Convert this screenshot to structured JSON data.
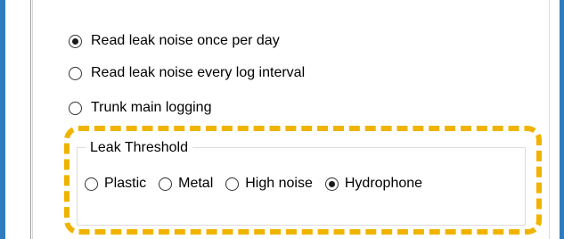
{
  "options": [
    {
      "label": "Read leak noise once per day",
      "checked": true
    },
    {
      "label": "Read leak noise every log interval",
      "checked": false
    },
    {
      "label": "Trunk main logging",
      "checked": false
    }
  ],
  "leak_threshold": {
    "title": "Leak Threshold",
    "options": [
      {
        "label": "Plastic",
        "checked": false
      },
      {
        "label": "Metal",
        "checked": false
      },
      {
        "label": "High noise",
        "checked": false
      },
      {
        "label": "Hydrophone",
        "checked": true
      }
    ]
  },
  "colors": {
    "frame": "#2e7bbf",
    "highlight": "#f0b400"
  }
}
